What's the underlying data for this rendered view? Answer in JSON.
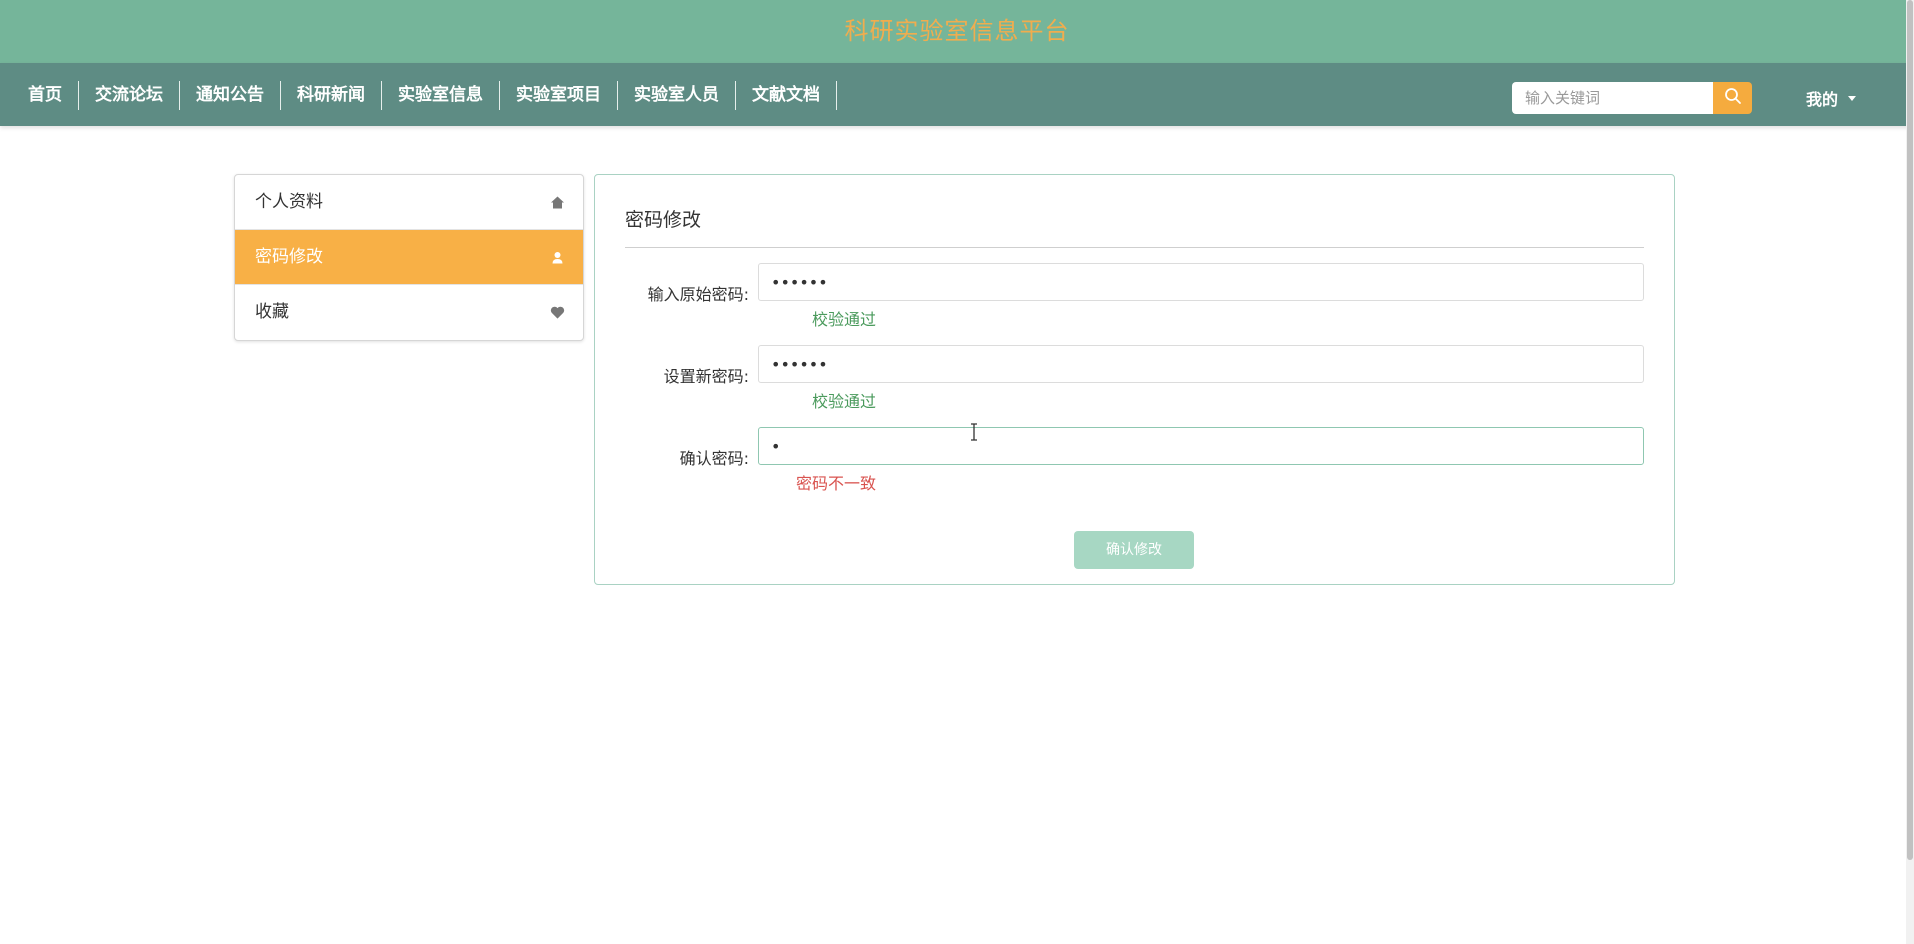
{
  "site": {
    "title": "科研实验室信息平台"
  },
  "nav": {
    "items": [
      {
        "label": "首页"
      },
      {
        "label": "交流论坛"
      },
      {
        "label": "通知公告"
      },
      {
        "label": "科研新闻"
      },
      {
        "label": "实验室信息"
      },
      {
        "label": "实验室项目"
      },
      {
        "label": "实验室人员"
      },
      {
        "label": "文献文档"
      }
    ],
    "search": {
      "placeholder": "输入关键词",
      "icon": "search-icon"
    },
    "user": {
      "label": "我的",
      "icon": "caret-down-icon"
    }
  },
  "sidebar": {
    "items": [
      {
        "label": "个人资料",
        "icon": "home-icon",
        "active": false
      },
      {
        "label": "密码修改",
        "icon": "user-icon",
        "active": true
      },
      {
        "label": "收藏",
        "icon": "heart-icon",
        "active": false
      }
    ]
  },
  "form": {
    "title": "密码修改",
    "old_password": {
      "label": "输入原始密码:",
      "value": "••••••",
      "message": "校验通过"
    },
    "new_password": {
      "label": "设置新密码:",
      "value": "••••••",
      "message": "校验通过"
    },
    "confirm_password": {
      "label": "确认密码:",
      "value": "•",
      "message": "密码不一致"
    },
    "submit_label": "确认修改"
  },
  "colors": {
    "header": "#75b59a",
    "nav": "#5e8c84",
    "accent": "#f8b046",
    "success": "#4a9a5c",
    "error": "#d9534f",
    "button_disabled": "#a7d7c3"
  }
}
